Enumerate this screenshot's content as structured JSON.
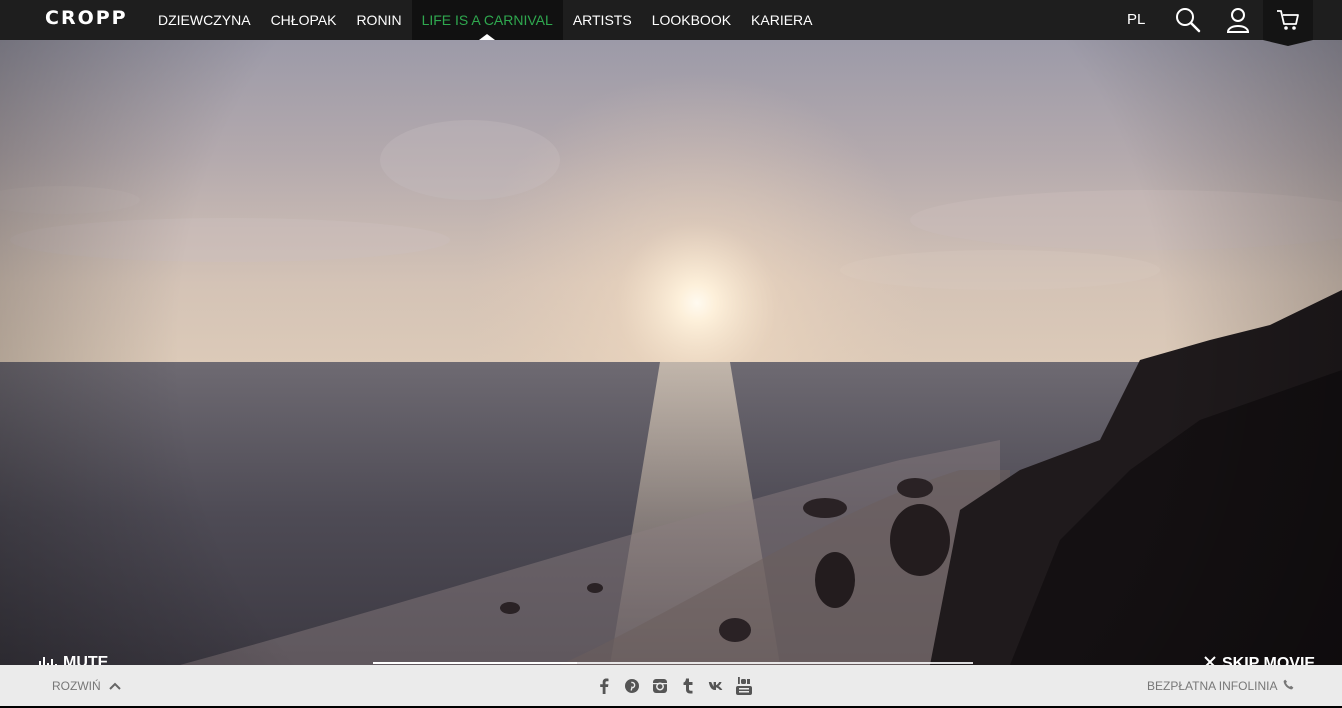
{
  "brand": {
    "logo": "CROPP"
  },
  "nav": {
    "items": [
      {
        "label": "DZIEWCZYNA"
      },
      {
        "label": "CHŁOPAK"
      },
      {
        "label": "RONIN"
      },
      {
        "label": "LIFE IS A CARNIVAL",
        "active": true
      },
      {
        "label": "ARTISTS"
      },
      {
        "label": "LOOKBOOK"
      },
      {
        "label": "KARIERA"
      }
    ],
    "language": "PL",
    "icons": [
      "search-icon",
      "user-icon",
      "cart-icon"
    ]
  },
  "video": {
    "mute_label": "MUTE",
    "skip_label": "SKIP MOVIE",
    "progress": 0.34,
    "colors": {
      "accent": "#2fa84f"
    }
  },
  "footer": {
    "expand_label": "ROZWIŃ",
    "socials": [
      "facebook-icon",
      "pinterest-icon",
      "instagram-icon",
      "tumblr-icon",
      "vk-icon",
      "youtube-icon"
    ],
    "helpline_label": "BEZPŁATNA INFOLINIA"
  }
}
